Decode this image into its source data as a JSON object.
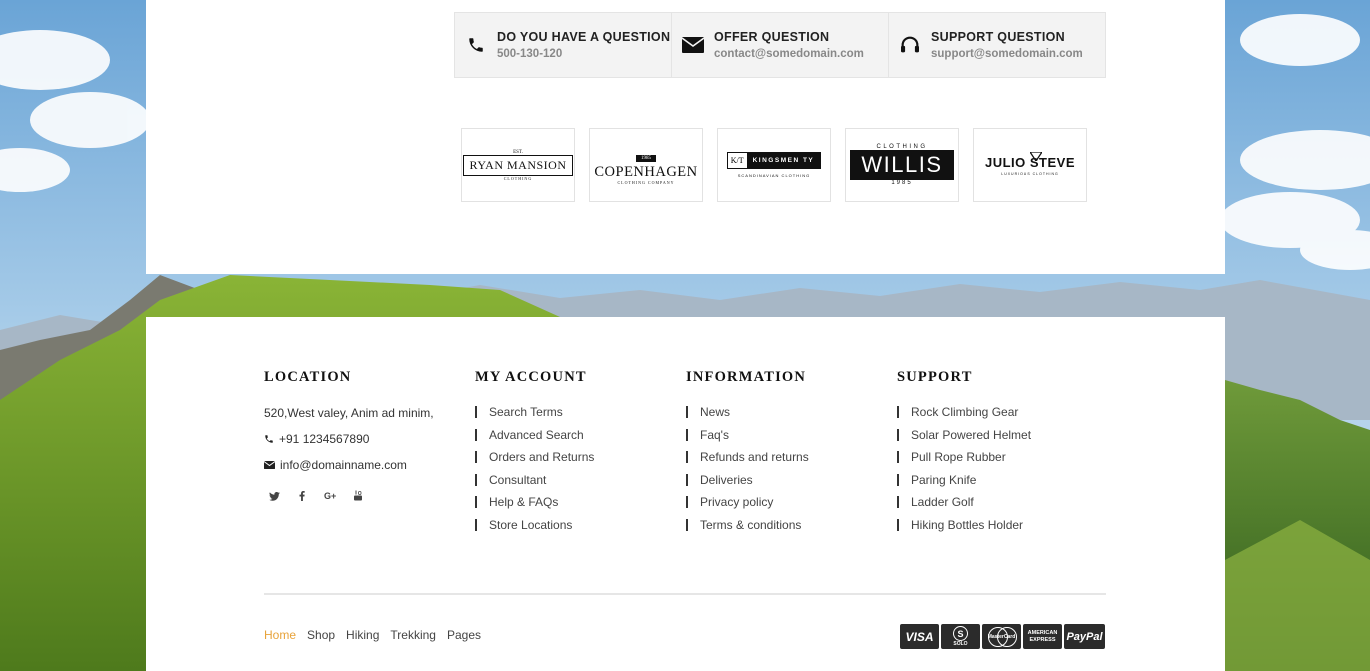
{
  "contacts": [
    {
      "icon": "phone-icon",
      "title": "DO YOU HAVE A QUESTION",
      "sub": "500-130-120"
    },
    {
      "icon": "envelope-icon",
      "title": "OFFER QUESTION",
      "sub": "contact@somedomain.com"
    },
    {
      "icon": "headphones-icon",
      "title": "SUPPORT QUESTION",
      "sub": "support@somedomain.com"
    }
  ],
  "brands": {
    "ryan": {
      "top": "EST.",
      "name": "RYAN MANSION",
      "sub": "CLOTHING"
    },
    "copenhagen": {
      "badge": "1985",
      "name": "COPENHAGEN",
      "sub": "CLOTHING COMPANY"
    },
    "kingsmen": {
      "mark": "K/T",
      "name": "KINGSMEN TY",
      "sub": "SCANDINAVIAN CLOTHING"
    },
    "willis": {
      "top": "CLOTHING",
      "name": "WILLIS",
      "year": "1985"
    },
    "julio": {
      "name": "JULIO STEVE",
      "sub": "LUXURIOUS CLOTHING"
    }
  },
  "footer": {
    "location": {
      "title": "LOCATION",
      "address": "520,West valey, Anim ad minim,",
      "phone": "+91 1234567890",
      "email": "info@domainname.com",
      "socials": [
        "twitter-icon",
        "facebook-icon",
        "google-plus-icon",
        "youtube-icon"
      ]
    },
    "account": {
      "title": "MY ACCOUNT",
      "links": [
        "Search Terms",
        "Advanced Search",
        "Orders and Returns",
        "Consultant",
        "Help & FAQs",
        "Store Locations"
      ]
    },
    "information": {
      "title": "INFORMATION",
      "links": [
        "News",
        "Faq's",
        "Refunds and returns",
        "Deliveries",
        "Privacy policy",
        "Terms & conditions"
      ]
    },
    "support": {
      "title": "SUPPORT",
      "links": [
        "Rock Climbing Gear",
        "Solar Powered Helmet",
        "Pull Rope Rubber",
        "Paring Knife",
        "Ladder Golf",
        "Hiking Bottles Holder"
      ]
    }
  },
  "bottom_nav": [
    "Home",
    "Shop",
    "Hiking",
    "Trekking",
    "Pages"
  ],
  "payments": {
    "visa": "VISA",
    "solo": "SOLO",
    "solo_mark": "S",
    "mastercard": "MasterCard",
    "amex_1": "AMERICAN",
    "amex_2": "EXPRESS",
    "paypal": "PayPal"
  },
  "colors": {
    "accent": "#e8a33a",
    "text": "#444444",
    "panel": "#ffffff"
  }
}
